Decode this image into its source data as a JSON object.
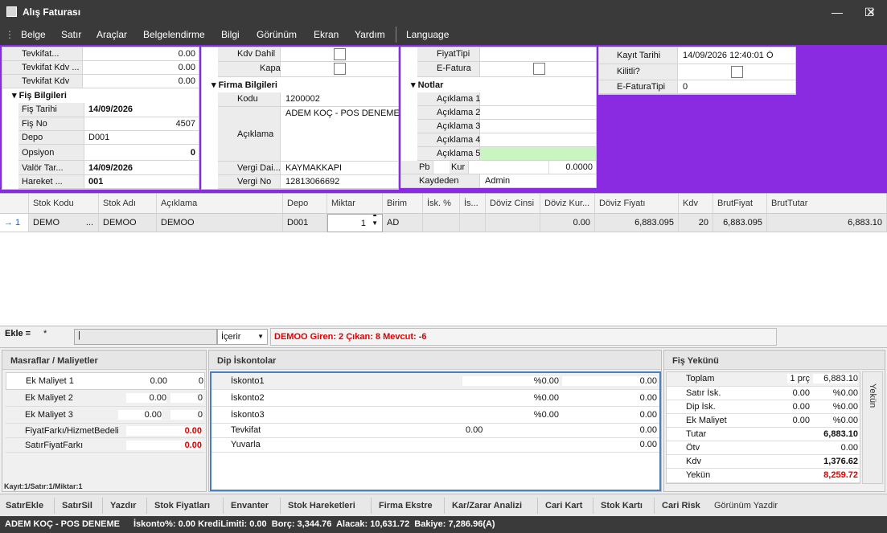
{
  "window": {
    "title": "Alış Faturası",
    "minimize": "—",
    "maximize": "☐",
    "close": "✕"
  },
  "menu": [
    "Belge",
    "Satır",
    "Araçlar",
    "Belgelendirme",
    "Bilgi",
    "Görünüm",
    "Ekran",
    "Yardım",
    "Language"
  ],
  "panel1": {
    "tevkifat_label": "Tevkifat...",
    "tevkifat_value": "0.00",
    "tevkifat_kdv1_label": "Tevkifat Kdv ...",
    "tevkifat_kdv1_value": "0.00",
    "tevkifat_kdv2_label": "Tevkifat Kdv",
    "tevkifat_kdv2_value": "0.00",
    "section": "Fiş Bilgileri",
    "fis_tarihi_label": "Fiş Tarihi",
    "fis_tarihi_value": "14/09/2026",
    "fis_no_label": "Fiş No",
    "fis_no_value": "4507",
    "depo_label": "Depo",
    "depo_value": "D001",
    "opsiyon_label": "Opsiyon",
    "opsiyon_value": "0",
    "valor_label": "Valör Tar...",
    "valor_value": "14/09/2026",
    "hareket_label": "Hareket ...",
    "hareket_value": "001"
  },
  "panel2": {
    "kdv_dahil_label": "Kdv Dahil",
    "kapali_label": "Kapalı",
    "section": "Firma Bilgileri",
    "kodu_label": "Kodu",
    "kodu_value": "1200002",
    "aciklama_label": "Açıklama",
    "aciklama_value": "ADEM KOÇ - POS DENEME",
    "vergi_daire_label": "Vergi Dai...",
    "vergi_daire_value": "KAYMAKKAPI",
    "vergi_no_label": "Vergi No",
    "vergi_no_value": "12813066692"
  },
  "panel3": {
    "fiyat_tipi_label": "FiyatTipi",
    "fiyat_tipi_value": "",
    "efatura_label": "E-Fatura",
    "section": "Notlar",
    "aciklama1_label": "Açıklama 1",
    "aciklama2_label": "Açıklama 2",
    "aciklama3_label": "Açıklama 3",
    "aciklama4_label": "Açıklama 4",
    "aciklama5_label": "Açıklama 5",
    "pb_label": "Pb",
    "kur_label": "Kur",
    "kur_value": "0.0000",
    "kaydeden_label": "Kaydeden",
    "kaydeden_value": "Admin"
  },
  "panel4": {
    "kayit_tarihi_label": "Kayıt Tarihi",
    "kayit_tarihi_value": "14/09/2026 12:40:01 Ö",
    "kilitli_label": "Kilitli?",
    "efatura_tipi_label": "E-FaturaTipi",
    "efatura_tipi_value": "0"
  },
  "grid": {
    "headers": [
      "Stok Kodu",
      "Stok Adı",
      "Açıklama",
      "Depo",
      "Miktar",
      "Birim",
      "İsk. %",
      "İs...",
      "Döviz Cinsi",
      "Döviz Kur...",
      "Döviz Fiyatı",
      "Kdv",
      "BrutFiyat",
      "BrutTutar"
    ],
    "row": {
      "indicator": "→ 1",
      "stok_kodu": "DEMO",
      "stok_kodu_ellipsis": "...",
      "stok_adi": "DEMOO",
      "aciklama": "DEMOO",
      "depo": "D001",
      "miktar": "1",
      "birim": "AD",
      "isk": "",
      "is": "",
      "doviz_cinsi": "",
      "doviz_kur": "0.00",
      "doviz_fiyati": "6,883.095",
      "kdv": "20",
      "brut_fiyat": "6,883.095",
      "brut_tutar": "6,883.10"
    }
  },
  "addbar": {
    "ekle_label": "Ekle =",
    "star": "*",
    "input_value": "",
    "mode": "İçerir",
    "info": "DEMOO Giren: 2 Çıkan: 8 Mevcut: -6"
  },
  "masraflar": {
    "title": "Masraflar / Maliyetler",
    "rows": [
      {
        "label": "Ek Maliyet 1",
        "v1": "0.00",
        "v2": "0"
      },
      {
        "label": "Ek Maliyet 2",
        "v1": "0.00",
        "v2": "0"
      },
      {
        "label": "Ek Maliyet 3",
        "v1": "0.00",
        "v2": "0"
      }
    ],
    "fiyat_farki_label": "FiyatFarkı/HizmetBedeli",
    "fiyat_farki_value": "0.00",
    "satir_fiyat_farki_label": "SatırFiyatFarkı",
    "satir_fiyat_farki_value": "0.00",
    "footer": "Kayıt:1/Satır:1/Miktar:1"
  },
  "dip": {
    "title": "Dip İskontolar",
    "rows": [
      {
        "label": "İskonto1",
        "pct": "%0.00",
        "val": "0.00"
      },
      {
        "label": "İskonto2",
        "pct": "%0.00",
        "val": "0.00"
      },
      {
        "label": "İskonto3",
        "pct": "%0.00",
        "val": "0.00"
      }
    ],
    "tevkifat_label": "Tevkifat",
    "tevkifat_v1": "0.00",
    "tevkifat_v2": "0.00",
    "yuvarla_label": "Yuvarla",
    "yuvarla_value": "0.00"
  },
  "yekun": {
    "title": "Fiş Yekünü",
    "side_tab": "Yekün",
    "toplam_label": "Toplam",
    "toplam_qty": "1 prç",
    "toplam_value": "6,883.10",
    "satir_isk_label": "Satır İsk.",
    "satir_isk_v1": "0.00",
    "satir_isk_v2": "%0.00",
    "dip_isk_label": "Dip İsk.",
    "dip_isk_v1": "0.00",
    "dip_isk_v2": "%0.00",
    "ek_maliyet_label": "Ek Maliyet",
    "ek_maliyet_v1": "0.00",
    "ek_maliyet_v2": "%0.00",
    "tutar_label": "Tutar",
    "tutar_value": "6,883.10",
    "otv_label": "Ötv",
    "otv_value": "0.00",
    "kdv_label": "Kdv",
    "kdv_value": "1,376.62",
    "yekun_label": "Yekün",
    "yekun_value": "8,259.72"
  },
  "toolbar": [
    "SatırEkle",
    "SatırSil",
    "Yazdır",
    "Stok Fiyatları",
    "Envanter",
    "Stok Hareketleri",
    "Firma Ekstre",
    "Kar/Zarar Analizi",
    "Cari Kart",
    "Stok Kartı",
    "Cari Risk",
    "Görünüm Yazdir"
  ],
  "status": {
    "firm": "ADEM KOÇ - POS DENEME",
    "details": "İskonto%: 0.00 KrediLimiti: 0.00  Borç: 3,344.76  Alacak: 10,631.72  Bakiye: 7,286.96(A)"
  },
  "colors": {
    "accent_purple": "#8a2be2",
    "chrome_dark": "#3a3a3a",
    "highlight_green": "#c8f5c0",
    "alert_red": "#e00000"
  }
}
